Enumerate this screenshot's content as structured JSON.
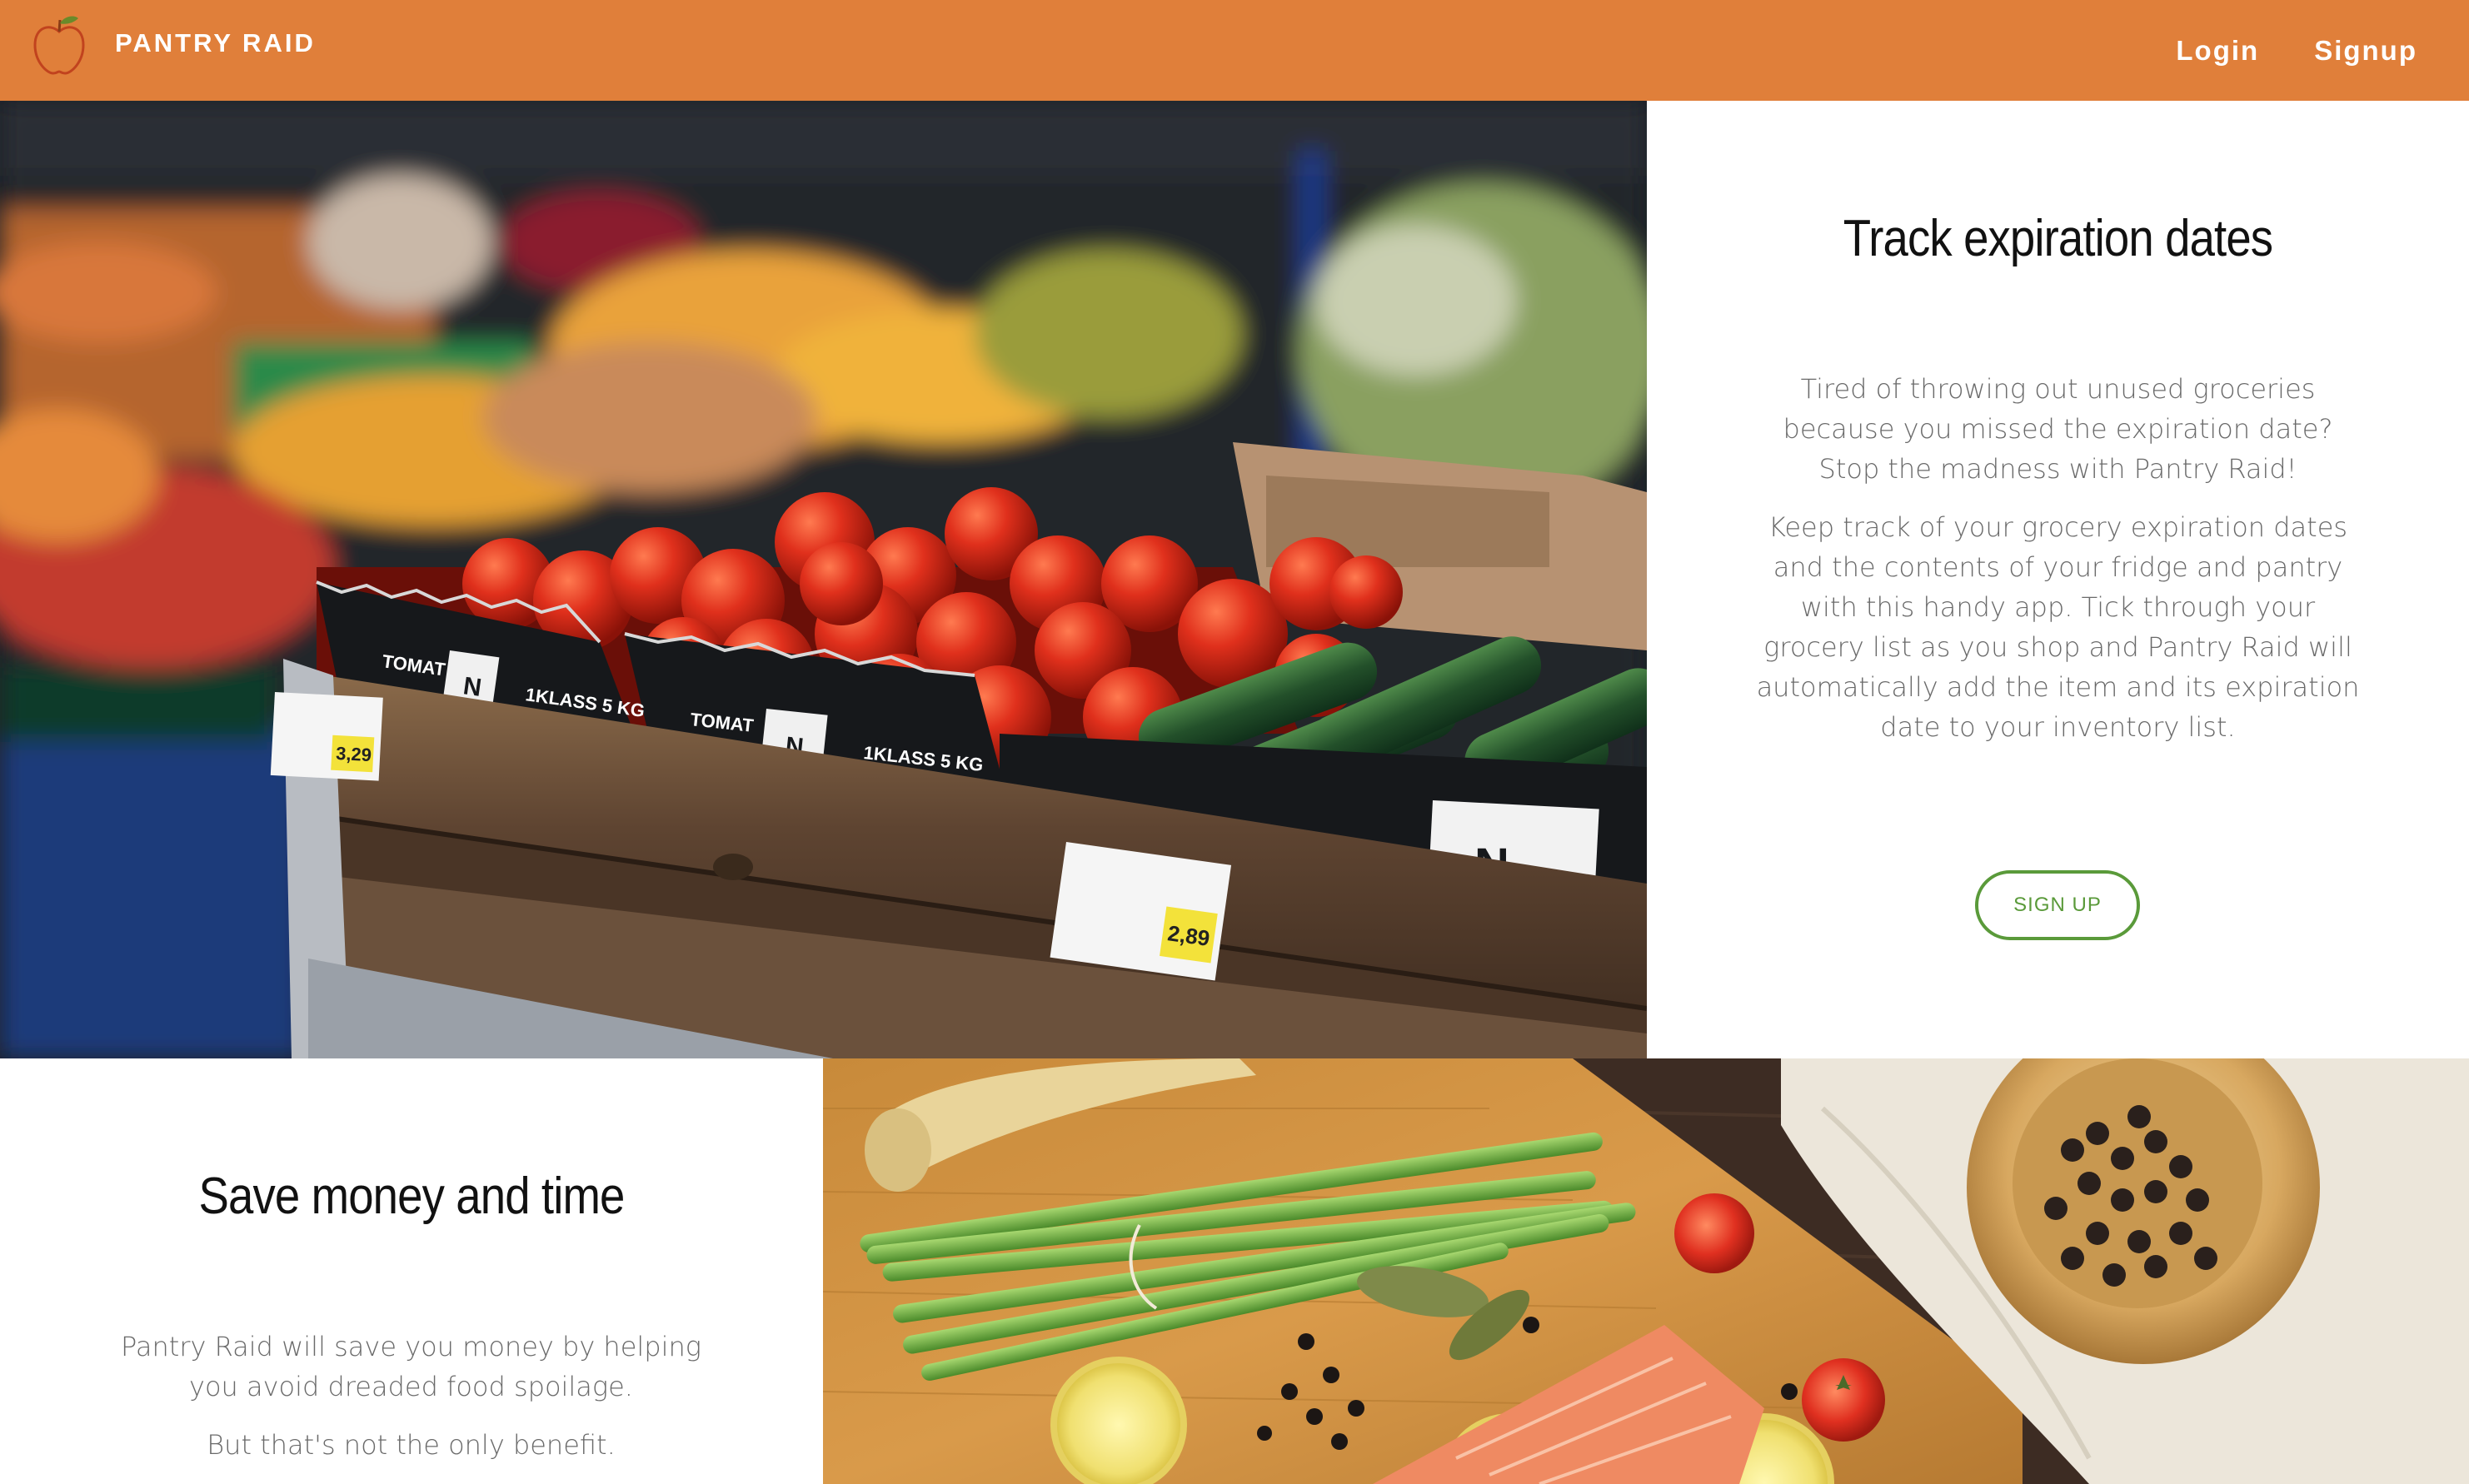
{
  "brand": {
    "name": "PANTRY RAID",
    "icon": "apple-icon"
  },
  "nav": {
    "login_label": "Login",
    "signup_label": "Signup"
  },
  "section_track": {
    "title": "Track expiration dates",
    "paragraph_1": "Tired of throwing out unused groceries because you missed the expiration date? Stop the madness with Pantry Raid!",
    "paragraph_2": "Keep track of your grocery expiration dates and the contents of your fridge and pantry with this handy app. Tick through your grocery list as you shop and Pantry Raid will automatically add the item and its expiration date to your inventory list.",
    "button_label": "SIGN UP",
    "image": "grocery-produce-photo"
  },
  "section_save": {
    "title": "Save money and time",
    "paragraph_1": "Pantry Raid will save you money by helping you avoid dreaded food spoilage.",
    "paragraph_2": "But that's not the only benefit.",
    "image": "cutting-board-food-photo"
  },
  "market_labels": {
    "tomat": "TOMAT",
    "klass": "1KLASS 5 KG",
    "price_1": "3,29",
    "price_2": "2,89",
    "brand_letter": "N"
  },
  "colors": {
    "navbar": "#e07f3a",
    "button_accent": "#5a9a3a",
    "body_text": "#6a6a6a",
    "title_text": "#111111"
  }
}
